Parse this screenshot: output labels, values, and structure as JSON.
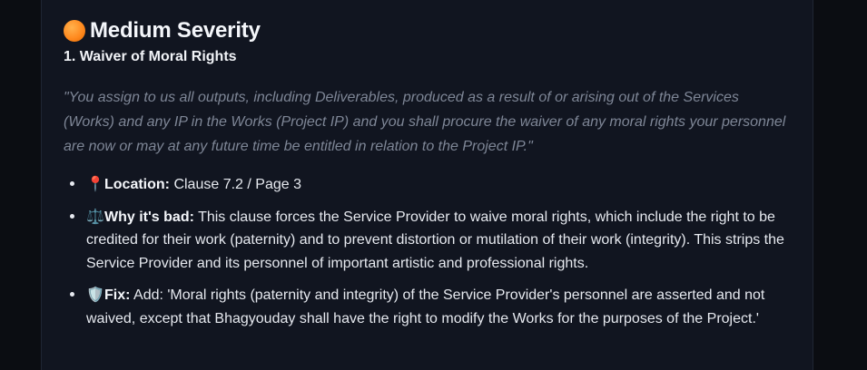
{
  "section": {
    "icon": "orange-circle-icon",
    "title": "Medium Severity",
    "colors": {
      "severity_dot": "#ff8a1f",
      "background": "#111520",
      "quote_text": "#7e8696"
    }
  },
  "issue": {
    "title": "1. Waiver of Moral Rights",
    "quote": "\"You assign to us all outputs, including Deliverables, produced as a result of or arising out of the Services (Works) and any IP in the Works (Project IP) and you shall procure the waiver of any moral rights your personnel are now or may at any future time be entitled in relation to the Project IP.\"",
    "points": [
      {
        "icon": "pin-icon",
        "emoji": "📍",
        "label": "Location:",
        "text": " Clause 7.2 / Page 3"
      },
      {
        "icon": "scale-icon",
        "emoji": "⚖️",
        "label": "Why it's bad:",
        "text": " This clause forces the Service Provider to waive moral rights, which include the right to be credited for their work (paternity) and to prevent distortion or mutilation of their work (integrity). This strips the Service Provider and its personnel of important artistic and professional rights."
      },
      {
        "icon": "shield-icon",
        "emoji": "🛡️",
        "label": "Fix:",
        "text": " Add: 'Moral rights (paternity and integrity) of the Service Provider's personnel are asserted and not waived, except that Bhagyouday shall have the right to modify the Works for the purposes of the Project.'"
      }
    ]
  }
}
